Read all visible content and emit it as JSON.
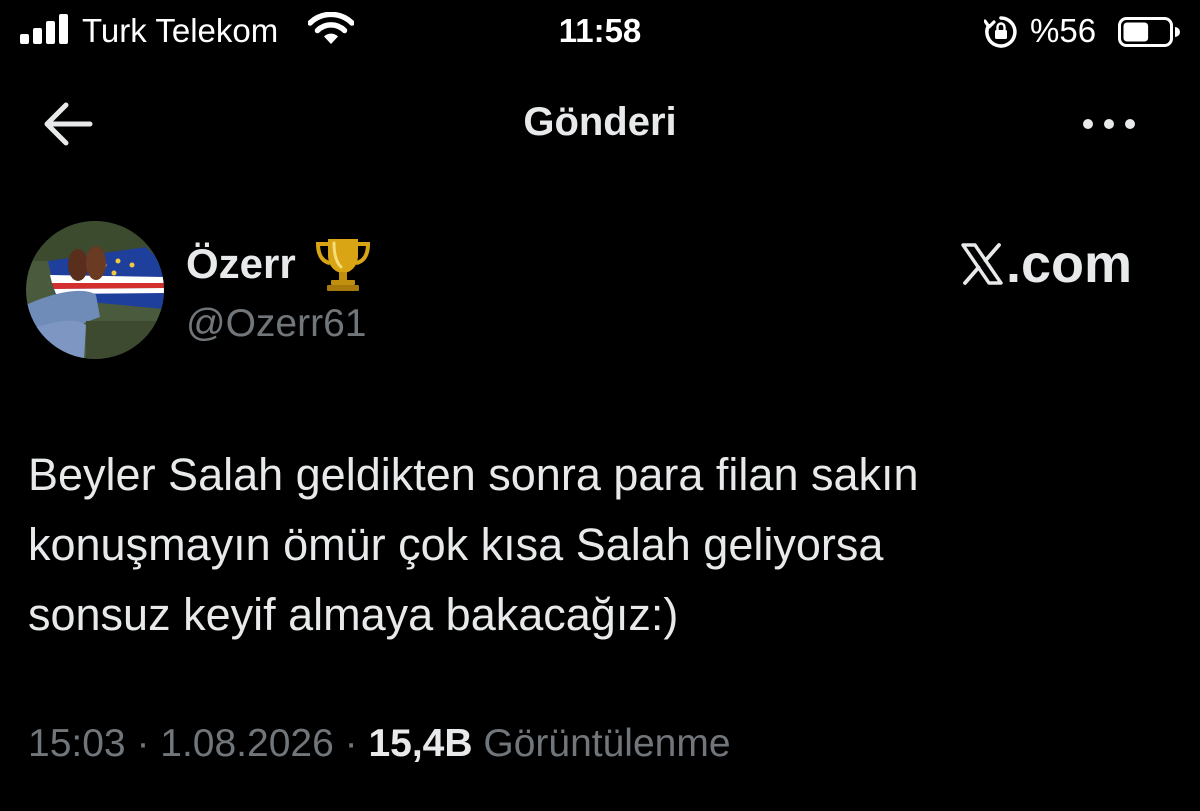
{
  "status_bar": {
    "carrier": "Turk Telekom",
    "time": "11:58",
    "battery_percent": "%56",
    "battery_level": 0.56,
    "signal_bars": 4,
    "icons": [
      "signal-icon",
      "wifi-icon",
      "orientation-lock-icon",
      "battery-icon"
    ]
  },
  "nav": {
    "title": "Gönderi",
    "back_icon": "arrow-left-icon",
    "more_icon": "more-horizontal-icon"
  },
  "post": {
    "author": {
      "display_name": "Özerr",
      "badge_icon": "trophy-icon",
      "handle": "@Ozerr61"
    },
    "watermark": {
      "logo_icon": "x-logo-icon",
      "text": ".com"
    },
    "text_lines": [
      "Beyler Salah geldikten sonra para filan sakın",
      "konuşmayın ömür çok kısa Salah geliyorsa",
      "sonsuz keyif almaya bakacağız:)"
    ],
    "meta": {
      "time": "15:03",
      "separator": " · ",
      "date": "1.08.2026",
      "views_count": "15,4B",
      "views_label": "Görüntülenme"
    }
  },
  "colors": {
    "background": "#000000",
    "primary_text": "#e7e9ea",
    "secondary_text": "#71767b",
    "trophy_gold": "#d4a017"
  }
}
